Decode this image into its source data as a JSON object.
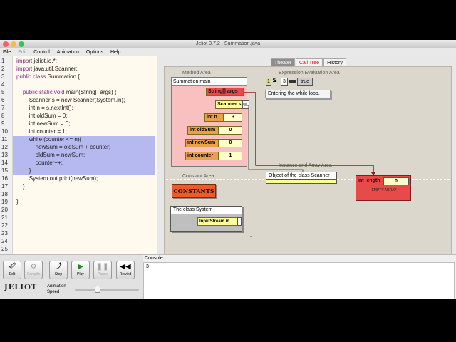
{
  "window": {
    "title": "Jeliot 3.7.2 - Summation.java"
  },
  "menu": {
    "items": [
      "File",
      "Edit",
      "Control",
      "Animation",
      "Options",
      "Help"
    ]
  },
  "editor": {
    "lines": [
      {
        "n": "1",
        "code": "import jeliot.io.*;"
      },
      {
        "n": "2",
        "code": "import java.util.Scanner;"
      },
      {
        "n": "3",
        "code": "public class Summation {"
      },
      {
        "n": "4",
        "code": ""
      },
      {
        "n": "5",
        "code": "    public static void main(String[] args) {"
      },
      {
        "n": "6",
        "code": "        Scanner s = new Scanner(System.in);"
      },
      {
        "n": "7",
        "code": "        int n = s.nextInt();"
      },
      {
        "n": "8",
        "code": "        int oldSum = 0;"
      },
      {
        "n": "9",
        "code": "        int newSum = 0;"
      },
      {
        "n": "10",
        "code": "        int counter = 1;"
      },
      {
        "n": "11",
        "code": "        while (counter <= n){"
      },
      {
        "n": "12",
        "code": "            newSum = oldSum + counter;"
      },
      {
        "n": "13",
        "code": "            oldSum = newSum;"
      },
      {
        "n": "14",
        "code": "            counter++;"
      },
      {
        "n": "15",
        "code": "        }"
      },
      {
        "n": "16",
        "code": "        System.out.print(newSum);"
      },
      {
        "n": "17",
        "code": "    }"
      },
      {
        "n": "18",
        "code": ""
      },
      {
        "n": "19",
        "code": "}"
      },
      {
        "n": "20",
        "code": ""
      },
      {
        "n": "21",
        "code": ""
      },
      {
        "n": "22",
        "code": ""
      },
      {
        "n": "23",
        "code": ""
      },
      {
        "n": "24",
        "code": ""
      },
      {
        "n": "25",
        "code": ""
      }
    ]
  },
  "tabs": [
    "Theater",
    "Call Tree",
    "History"
  ],
  "theater": {
    "method_area": "Method Area",
    "expression_area": "Expression Evaluation Area",
    "instance_area": "Instance and Array Area",
    "constant_area": "Constant Area",
    "frame_title": "Summation.main",
    "vars": [
      {
        "name": "String[] args",
        "value": ""
      },
      {
        "name": "Scanner s",
        "value": ""
      },
      {
        "name": "int n",
        "value": "3"
      },
      {
        "name": "int oldSum",
        "value": "0"
      },
      {
        "name": "int newSum",
        "value": "0"
      },
      {
        "name": "int counter",
        "value": "1"
      }
    ],
    "expr": {
      "left": "1",
      "op": "≤",
      "right": "3",
      "result": "true"
    },
    "expr_message": "Entering the while loop.",
    "scanner_object": "Object of the class Scanner",
    "array_length_label": "int length",
    "array_length_value": "0",
    "empty_array": "EMPTY ARRAY",
    "constants": "CONSTANTS",
    "class_system": "The class System",
    "system_field": "InputStream in"
  },
  "toolbar": {
    "edit": "Edit",
    "compile": "Compile",
    "step": "Step",
    "play": "Play",
    "pause": "Pause",
    "rewind": "Rewind",
    "animation_speed": "Animation Speed",
    "logo": "JELIOT"
  },
  "console": {
    "label": "Console",
    "output": "3"
  }
}
